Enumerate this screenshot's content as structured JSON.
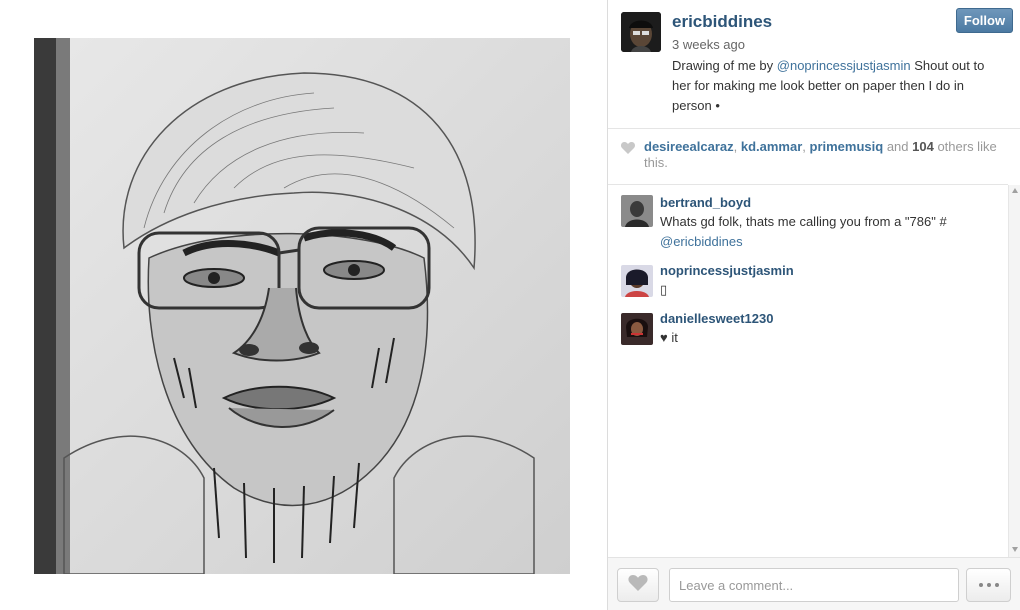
{
  "post": {
    "owner": "ericbiddines",
    "time": "3 weeks ago",
    "follow_label": "Follow",
    "caption_before": "Drawing of me by ",
    "caption_mention": "@noprincessjustjasmin",
    "caption_after": " Shout out to her for making me look better on paper then I do in person •"
  },
  "likes": {
    "user1": "desireealcaraz",
    "sep1": ", ",
    "user2": "kd.ammar",
    "sep2": ", ",
    "user3": "primemusiq",
    "and": " and ",
    "count": "104",
    "rest": " others like this."
  },
  "comments": [
    {
      "user": "bertrand_boyd",
      "text": "Whats gd folk, thats me calling you from a \"786\" #",
      "mention": "@ericbiddines"
    },
    {
      "user": "noprincessjustjasmin",
      "text": "▯"
    },
    {
      "user": "daniellesweet1230",
      "text": "♥ it"
    }
  ],
  "footer": {
    "comment_placeholder": "Leave a comment..."
  },
  "icons": {
    "like": "heart-icon",
    "more": "more-dots-icon",
    "likes_indicator": "heart-icon"
  },
  "colors": {
    "username": "#2d5578",
    "mention": "#3f729b",
    "follow_button": "#4c7aa2"
  }
}
